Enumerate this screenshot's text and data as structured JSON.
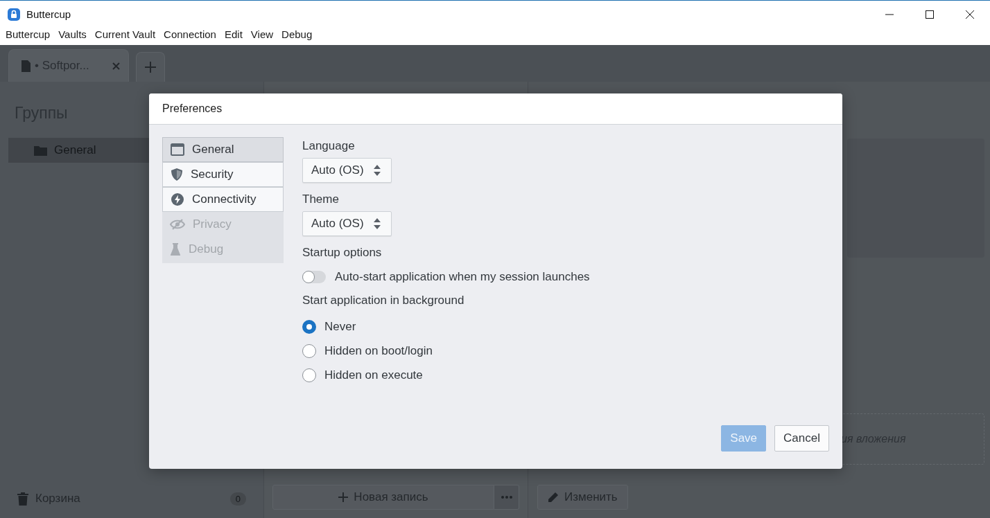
{
  "window": {
    "title": "Buttercup"
  },
  "menu": [
    "Buttercup",
    "Vaults",
    "Current Vault",
    "Connection",
    "Edit",
    "View",
    "Debug"
  ],
  "vault_tabs": [
    {
      "label": "• Softpor...",
      "selected": true
    }
  ],
  "sidebar": {
    "title": "Группы",
    "groups": [
      {
        "label": "General",
        "selected": true
      }
    ],
    "trash": {
      "label": "Корзина",
      "count": "0"
    }
  },
  "entries": {
    "new_entry": "Новая запись"
  },
  "details": {
    "edit": "Изменить",
    "attachments_hint": "ия вложения"
  },
  "dialog": {
    "title": "Preferences",
    "sections": [
      {
        "kind": "window",
        "label": "General",
        "selected": true,
        "disabled": false
      },
      {
        "kind": "shield",
        "label": "Security",
        "selected": false,
        "disabled": false
      },
      {
        "kind": "bolt",
        "label": "Connectivity",
        "selected": false,
        "disabled": false
      },
      {
        "kind": "eye",
        "label": "Privacy",
        "selected": false,
        "disabled": true
      },
      {
        "kind": "flask",
        "label": "Debug",
        "selected": false,
        "disabled": true
      }
    ],
    "language": {
      "label": "Language",
      "value": "Auto (OS)"
    },
    "theme": {
      "label": "Theme",
      "value": "Auto (OS)"
    },
    "startup_title": "Startup options",
    "autostart": {
      "label": "Auto-start application when my session launches",
      "on": false
    },
    "background_title": "Start application in background",
    "background_options": [
      {
        "label": "Never",
        "selected": true
      },
      {
        "label": "Hidden on boot/login",
        "selected": false
      },
      {
        "label": "Hidden on execute",
        "selected": false
      }
    ],
    "save": {
      "label": "Save",
      "disabled": true
    },
    "cancel": {
      "label": "Cancel"
    }
  }
}
